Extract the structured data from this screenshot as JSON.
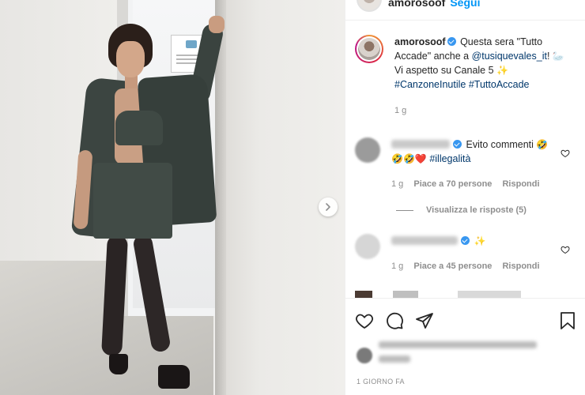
{
  "post": {
    "top_username": "amorosoof",
    "top_follow": "Segui",
    "caption": {
      "username": "amorosoof",
      "text_1": "Questa sera \"Tutto Accade\" anche a ",
      "mention": "@tusiquevales_it",
      "text_2": "! ",
      "emoji_swan": "🦢",
      "text_3": "Vi aspetto su Canale 5 ",
      "emoji_sparkle": "✨",
      "hashtag_1": "#CanzoneInutile",
      "hashtag_2": "#TuttoAccade",
      "time": "1 g"
    },
    "comments": [
      {
        "text": "Evito commenti ",
        "emoji_line1": "🤣",
        "emoji_line2": "🤣🤣❤️",
        "hashtag": "#illegalità",
        "time": "1 g",
        "likes": "Piace a 70 persone",
        "reply": "Rispondi",
        "view_replies": "Visualizza le risposte (5)"
      },
      {
        "emoji": "✨",
        "time": "1 g",
        "likes": "Piace a 45 persone",
        "reply": "Rispondi"
      }
    ],
    "time_ago": "1 GIORNO FA"
  },
  "icons": {
    "heart": "heart-icon",
    "comment": "comment-icon",
    "share": "share-icon",
    "save": "bookmark-icon",
    "next": "chevron-right-icon"
  },
  "colors": {
    "link": "#00376b",
    "accent": "#0095f6",
    "verified": "#3897f0",
    "muted": "#8e8e8e"
  }
}
